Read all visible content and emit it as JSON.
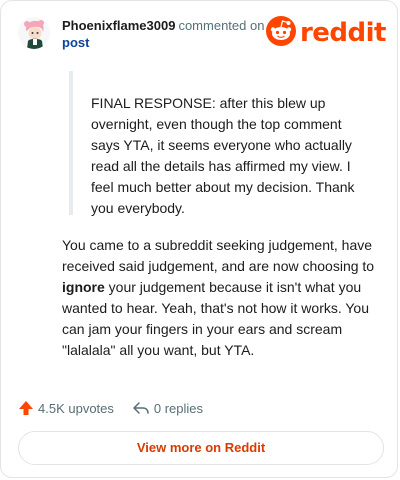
{
  "header": {
    "username": "Phoenixflame3009",
    "action": "commented on",
    "post_link": "post",
    "logo_text": "reddit"
  },
  "quote": {
    "text": "FINAL RESPONSE: after this blew up overnight, even though the top comment says YTA, it seems everyone who actually read all the details has affirmed my view. I feel much better about my decision. Thank you everybody."
  },
  "comment": {
    "before_bold": "You came to a subreddit seeking judgement, have received said judgement, and are now choosing to ",
    "bold": "ignore",
    "after_bold": " your judgement because it isn't what you wanted to hear. Yeah, that's not how it works. You can jam your fingers in your ears and scream \"lalalala\" all you want, but YTA."
  },
  "footer": {
    "upvotes": "4.5K upvotes",
    "replies": "0 replies",
    "view_more": "View more on Reddit"
  },
  "colors": {
    "brand": "#ff4500",
    "link": "#0a449b",
    "muted": "#576f76"
  },
  "icons": {
    "avatar": "avatar",
    "logo": "reddit-snoo-icon",
    "upvote": "upvote-arrow-icon",
    "reply": "reply-arrow-icon"
  }
}
